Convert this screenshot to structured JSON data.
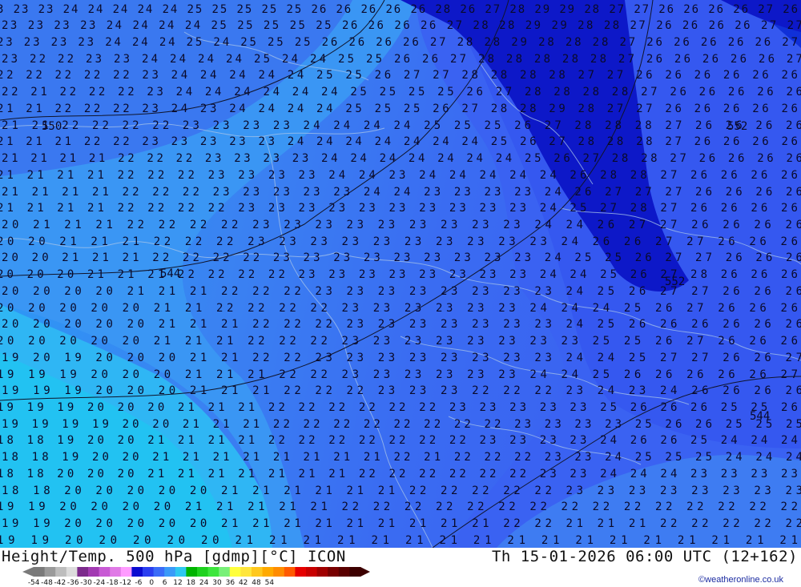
{
  "title": {
    "left": "Height/Temp. 500 hPa [gdmp][°C] ICON",
    "right": "Th 15-01-2026 06:00 UTC (12+162)"
  },
  "credit": "©weatheronline.co.uk",
  "legend": {
    "ticks": [
      "-54",
      "-48",
      "-42",
      "-36",
      "-30",
      "-24",
      "-18",
      "-12",
      "-6",
      "0",
      "6",
      "12",
      "18",
      "24",
      "30",
      "36",
      "42",
      "48",
      "54"
    ],
    "colors": [
      "#7a7a7a",
      "#9a9a9a",
      "#bdbdbd",
      "#dcdcdc",
      "#7c2a8c",
      "#a23ab2",
      "#c85ad4",
      "#e07ae6",
      "#ff9bff",
      "#0b0bd0",
      "#2a3ef0",
      "#3a6cf8",
      "#3a9af8",
      "#2ec8f0",
      "#00b400",
      "#1ed21e",
      "#3ce63c",
      "#78f078",
      "#ffff3c",
      "#ffe63c",
      "#ffc81e",
      "#ffaa00",
      "#ff8c00",
      "#ff5a00",
      "#e60000",
      "#c80000",
      "#a00000",
      "#780000",
      "#5a0000",
      "#3c0000"
    ]
  },
  "map": {
    "place_labels": [
      "550",
      "544",
      "552",
      "544",
      "552"
    ],
    "contour_label_rows": [
      "3 23 23 24 24 24 24 24 25 25 25 25 25 26 26 26 26 26 28 26 27 28 29 29 28 27 27 26 26 26 26 27 26",
      "23 23 23 23 24 24 24 24 25 25 25 25 25 26 26 26 26 27 28 28 29 29 28 28 27 26 26 26 26 27 27",
      "23 23 23 23 24 24 24 25 24 25 25 25 26 26 26 26 27 28 28 29 28 28 28 27 26 26 26 26 26 27",
      "23 22 22 23 23 24 24 24 24 25 24 24 25 25 26 26 27 28 28 28 28 28 27 26 26 26 26 26 27",
      "22 22 22 22 22 23 24 24 24 24 24 25 25 26 27 27 28 28 28 28 27 27 26 26 26 26 26 26",
      "22 21 22 22 22 23 24 24 24 24 24 24 25 25 25 25 26 27 28 28 28 28 27 26 26 26 26 26",
      "21 21 22 22 22 23 24 23 24 24 24 24 25 25 25 26 27 28 28 29 28 27 27 26 26 26 26 26",
      "21 21 22 22 22 22 23 23 23 23 24 24 24 24 25 25 25 26 27 28 28 28 27 26 26 26 26",
      "21 21 21 22 22 23 23 23 23 23 24 24 24 24 24 24 24 25 26 27 28 28 28 27 26 26 26 26",
      "21 21 21 21 22 22 22 23 23 23 23 24 24 24 24 24 24 24 25 26 27 28 28 27 26 26 26 26",
      "21 21 21 21 22 22 22 23 23 23 23 24 24 23 24 24 24 24 24 26 28 28 27 26 26 26 26",
      "21 21 21 21 22 22 22 23 23 23 23 23 24 24 23 23 23 23 24 26 27 27 27 26 26 26 26",
      "21 21 21 21 22 22 22 22 23 23 23 23 23 23 23 23 23 23 24 25 27 28 27 26 26 26 26",
      "20 21 21 21 22 22 22 22 23 23 23 23 23 23 23 23 23 24 24 26 27 27 26 26 26 26",
      "20 20 21 21 21 22 22 22 23 23 23 23 23 23 23 23 23 23 24 26 26 27 27 26 26 26",
      "20 20 21 21 21 22 22 22 22 23 23 23 23 23 23 23 23 23 24 25 25 26 27 27 26 26 26",
      "20 20 20 21 21 21 22 22 22 22 23 23 23 23 23 23 23 23 24 24 25 26 27 28 26 26 26",
      "20 20 20 20 21 21 21 22 22 22 23 23 23 23 23 23 23 23 24 25 26 27 27 26 26 26",
      "20 20 20 20 20 21 21 22 22 22 22 23 23 23 23 23 23 24 24 24 25 26 27 26 26 26",
      "20 20 20 20 20 21 21 21 22 22 22 23 23 23 23 23 23 23 24 25 26 26 26 26 26 26",
      "20 20 20 20 20 21 21 21 22 22 22 23 23 23 23 23 23 23 23 25 25 26 27 26 26 26",
      "19 20 19 20 20 20 21 21 22 22 23 23 23 23 23 23 23 23 24 24 25 27 27 26 26 27",
      "19 19 19 20 20 20 21 21 21 22 22 23 23 23 23 23 23 24 24 25 26 26 26 26 26 27",
      "19 19 19 20 20 20 21 21 21 22 22 22 23 23 23 22 22 22 23 24 23 24 26 26 26 26",
      "19 19 19 20 20 20 21 21 21 22 22 22 22 22 22 23 23 23 23 23 25 26 26 26 25 25 26",
      "19 19 19 19 20 20 21 21 21 22 22 22 22 22 22 22 22 23 23 23 23 25 26 26 25 25 25",
      "18 18 19 20 20 21 21 21 21 22 22 22 22 22 22 22 23 23 23 23 24 26 26 25 24 24 24",
      "18 18 19 20 20 21 21 21 21 21 21 21 21 22 21 22 22 22 23 23 24 25 25 25 24 24 24",
      "18 18 20 20 20 21 21 21 21 21 21 21 22 22 22 22 22 22 23 23 24 24 24 23 23 23 23",
      "18 18 20 20 20 20 20 21 21 21 21 21 21 22 22 22 22 22 23 23 23 23 23 23 23 23",
      "19 19 20 20 20 20 21 21 21 21 21 22 22 22 22 22 22 22 22 22 22 22 22 22 22 22",
      "19 19 20 20 20 20 20 21 21 21 21 21 21 21 21 21 22 22 21 21 21 22 22 22 22 22",
      "19 19 20 20 20 20 20 21 21 21 21 21 21 21 21 21 21 21 21 21 21 21 21 21"
    ]
  }
}
